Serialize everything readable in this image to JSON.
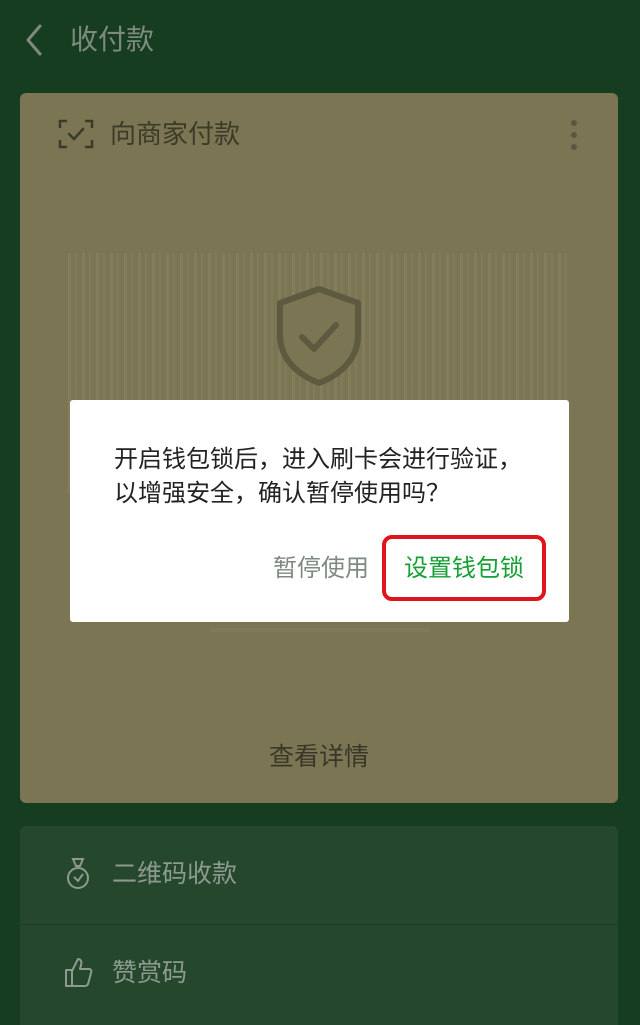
{
  "header": {
    "title": "收付款"
  },
  "pay_card": {
    "title": "向商家付款",
    "view_details": "查看详情"
  },
  "dialog": {
    "message": "开启钱包锁后，进入刷卡会进行验证，以增强安全，确认暂停使用吗？",
    "pause_label": "暂停使用",
    "set_lock_label": "设置钱包锁",
    "highlight_color": "#e0141b",
    "primary_color": "#14a032"
  },
  "list": {
    "items": [
      {
        "label": "二维码收款",
        "icon": "money-bag-icon"
      },
      {
        "label": "赞赏码",
        "icon": "thumbs-up-icon"
      }
    ]
  },
  "colors": {
    "background": "#173d20",
    "card_overlay": "#7b7553",
    "list_card": "#25472c"
  }
}
